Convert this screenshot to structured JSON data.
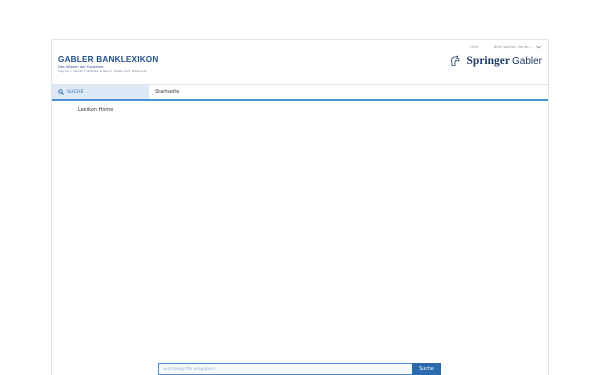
{
  "header": {
    "title": "GABLER BANKLEXIKON",
    "subtitle": "Das Wissen der Experten.",
    "editors": "Hrsg von L. Grandis, F Obstmeis, R. Reut, U. Schäfe und E. Wackhoude",
    "help_link": "Hilfe",
    "language_select": "Bitte wählen Sie ein...",
    "brand": {
      "springer": "Springer",
      "gabler": "Gabler"
    }
  },
  "nav": {
    "search_tab": "SUCHE",
    "home_tab": "Startseite"
  },
  "sidebar": {
    "home_link": "Lexikon Home"
  },
  "search": {
    "placeholder": "Suchbegriffe eingeben",
    "value": "",
    "submit_label": "Suche"
  },
  "colors": {
    "brand_blue": "#1e4f8c",
    "accent_blue": "#4a8fd0",
    "button_blue": "#2a6aad",
    "tab_bg": "#dde9f6"
  },
  "icons": [
    "search-icon",
    "horse-icon",
    "chevron-down-icon"
  ]
}
